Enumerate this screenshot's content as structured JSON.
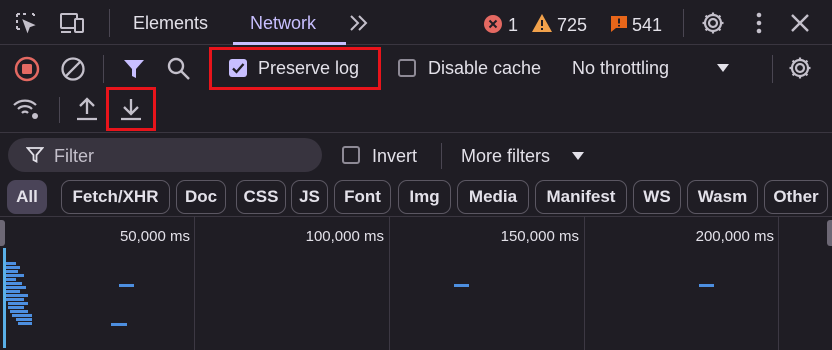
{
  "tabs": {
    "elements": "Elements",
    "network": "Network"
  },
  "status": {
    "errors": "1",
    "warnings": "725",
    "issues": "541"
  },
  "toolbar": {
    "preserve_log": "Preserve log",
    "disable_cache": "Disable cache",
    "throttling": "No throttling",
    "preserve_log_checked": true,
    "disable_cache_checked": false
  },
  "filter": {
    "placeholder": "Filter",
    "invert": "Invert",
    "more_filters": "More filters",
    "invert_checked": false
  },
  "type_filters": [
    "All",
    "Fetch/XHR",
    "Doc",
    "CSS",
    "JS",
    "Font",
    "Img",
    "Media",
    "Manifest",
    "WS",
    "Wasm",
    "Other"
  ],
  "active_type_filter": "All",
  "overview": {
    "tick_labels": [
      "50,000 ms",
      "100,000 ms",
      "150,000 ms",
      "200,000 ms"
    ]
  },
  "colors": {
    "accent": "#c8bfff",
    "error": "#e46962",
    "warning": "#f1a14b",
    "issue": "#e8661a",
    "highlight_box": "#e8141b",
    "request_bar": "#4d8fe0"
  }
}
